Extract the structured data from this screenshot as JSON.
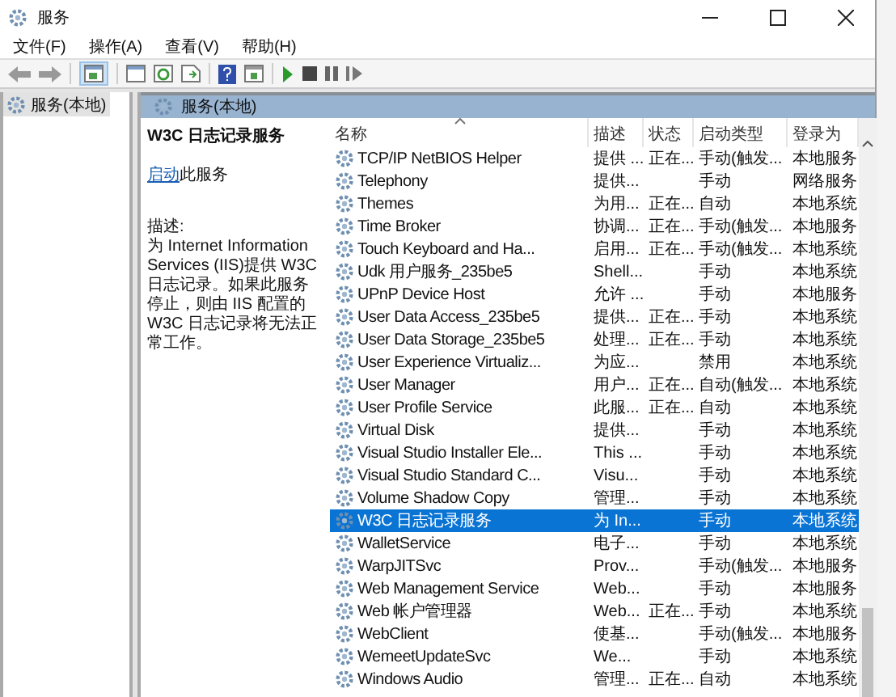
{
  "window": {
    "title": "服务"
  },
  "menu": [
    "文件(F)",
    "操作(A)",
    "查看(V)",
    "帮助(H)"
  ],
  "tree": {
    "items": [
      {
        "label": "服务(本地)",
        "selected": true
      }
    ]
  },
  "panel_header": "服务(本地)",
  "details": {
    "title": "W3C 日志记录服务",
    "start_link": "启动",
    "start_suffix": "此服务",
    "description_label": "描述:",
    "description": "为 Internet Information Services (IIS)提供 W3C 日志记录。如果此服务停止，则由 IIS 配置的 W3C 日志记录将无法正常工作。"
  },
  "table": {
    "columns": [
      {
        "label": "名称",
        "sorted": true
      },
      {
        "label": "描述",
        "sorted": false
      },
      {
        "label": "状态",
        "sorted": false
      },
      {
        "label": "启动类型",
        "sorted": false
      },
      {
        "label": "登录为",
        "sorted": false
      }
    ],
    "rows": [
      {
        "name": "TCP/IP NetBIOS Helper",
        "description": "提供 ...",
        "status": "正在...",
        "startup": "手动(触发...",
        "logon": "本地服务",
        "selected": false
      },
      {
        "name": "Telephony",
        "description": "提供...",
        "status": "",
        "startup": "手动",
        "logon": "网络服务",
        "selected": false
      },
      {
        "name": "Themes",
        "description": "为用...",
        "status": "正在...",
        "startup": "自动",
        "logon": "本地系统",
        "selected": false
      },
      {
        "name": "Time Broker",
        "description": "协调...",
        "status": "正在...",
        "startup": "手动(触发...",
        "logon": "本地服务",
        "selected": false
      },
      {
        "name": "Touch Keyboard and Ha...",
        "description": "启用...",
        "status": "正在...",
        "startup": "手动(触发...",
        "logon": "本地系统",
        "selected": false
      },
      {
        "name": "Udk 用户服务_235be5",
        "description": "Shell...",
        "status": "",
        "startup": "手动",
        "logon": "本地系统",
        "selected": false
      },
      {
        "name": "UPnP Device Host",
        "description": "允许 ...",
        "status": "",
        "startup": "手动",
        "logon": "本地服务",
        "selected": false
      },
      {
        "name": "User Data Access_235be5",
        "description": "提供...",
        "status": "正在...",
        "startup": "手动",
        "logon": "本地系统",
        "selected": false
      },
      {
        "name": "User Data Storage_235be5",
        "description": "处理...",
        "status": "正在...",
        "startup": "手动",
        "logon": "本地系统",
        "selected": false
      },
      {
        "name": "User Experience Virtualiz...",
        "description": "为应...",
        "status": "",
        "startup": "禁用",
        "logon": "本地系统",
        "selected": false
      },
      {
        "name": "User Manager",
        "description": "用户...",
        "status": "正在...",
        "startup": "自动(触发...",
        "logon": "本地系统",
        "selected": false
      },
      {
        "name": "User Profile Service",
        "description": "此服...",
        "status": "正在...",
        "startup": "自动",
        "logon": "本地系统",
        "selected": false
      },
      {
        "name": "Virtual Disk",
        "description": "提供...",
        "status": "",
        "startup": "手动",
        "logon": "本地系统",
        "selected": false
      },
      {
        "name": "Visual Studio Installer Ele...",
        "description": "This ...",
        "status": "",
        "startup": "手动",
        "logon": "本地系统",
        "selected": false
      },
      {
        "name": "Visual Studio Standard C...",
        "description": "Visu...",
        "status": "",
        "startup": "手动",
        "logon": "本地系统",
        "selected": false
      },
      {
        "name": "Volume Shadow Copy",
        "description": "管理...",
        "status": "",
        "startup": "手动",
        "logon": "本地系统",
        "selected": false
      },
      {
        "name": "W3C 日志记录服务",
        "description": "为 In...",
        "status": "",
        "startup": "手动",
        "logon": "本地系统",
        "selected": true
      },
      {
        "name": "WalletService",
        "description": "电子...",
        "status": "",
        "startup": "手动",
        "logon": "本地系统",
        "selected": false
      },
      {
        "name": "WarpJITSvc",
        "description": "Prov...",
        "status": "",
        "startup": "手动(触发...",
        "logon": "本地服务",
        "selected": false
      },
      {
        "name": "Web Management Service",
        "description": "Web...",
        "status": "",
        "startup": "手动",
        "logon": "本地服务",
        "selected": false
      },
      {
        "name": "Web 帐户管理器",
        "description": "Web...",
        "status": "正在...",
        "startup": "手动",
        "logon": "本地系统",
        "selected": false
      },
      {
        "name": "WebClient",
        "description": "使基...",
        "status": "",
        "startup": "手动(触发...",
        "logon": "本地服务",
        "selected": false
      },
      {
        "name": "WemeetUpdateSvc",
        "description": "We...",
        "status": "",
        "startup": "手动",
        "logon": "本地系统",
        "selected": false
      },
      {
        "name": "Windows Audio",
        "description": "管理...",
        "status": "正在...",
        "startup": "自动",
        "logon": "本地系统",
        "selected": false
      }
    ]
  }
}
